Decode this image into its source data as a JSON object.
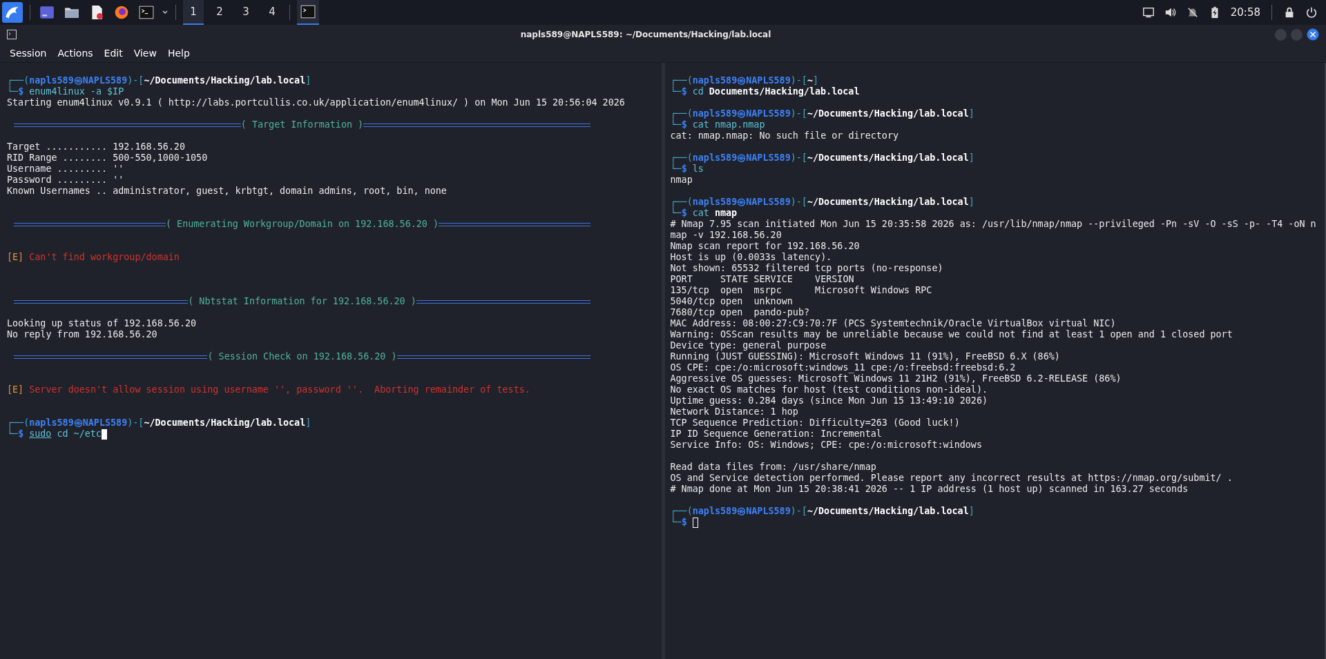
{
  "taskbar": {
    "workspaces": [
      {
        "label": "1",
        "selected": true
      },
      {
        "label": "2",
        "selected": false
      },
      {
        "label": "3",
        "selected": false
      },
      {
        "label": "4",
        "selected": false
      }
    ],
    "clock": "20:58"
  },
  "window": {
    "title": "napls589@NAPLS589: ~/Documents/Hacking/lab.local"
  },
  "menu": [
    "Session",
    "Actions",
    "Edit",
    "View",
    "Help"
  ],
  "panes": [
    {
      "focused": true,
      "lines": [
        {
          "kind": "prompt",
          "frame": "┌──(",
          "user": "napls589㉿NAPLS589",
          "sep": ")-[",
          "path": "~/Documents/Hacking/lab.local",
          "end": "]"
        },
        {
          "kind": "command",
          "prefix": "└─$",
          "segments": [
            {
              "kind": "program",
              "text": "enum4linux -a $IP"
            }
          ]
        },
        {
          "kind": "output",
          "text": "Starting enum4linux v0.9.1 ( http://labs.portcullis.co.uk/application/enum4linux/ ) on Mon Jun 15 20:56:04 2026"
        },
        {
          "kind": "blank"
        },
        {
          "kind": "banner",
          "text": "( Target Information )"
        },
        {
          "kind": "blank"
        },
        {
          "kind": "output",
          "text": "Target ........... 192.168.56.20"
        },
        {
          "kind": "output",
          "text": "RID Range ........ 500-550,1000-1050"
        },
        {
          "kind": "output",
          "text": "Username ......... ''"
        },
        {
          "kind": "output",
          "text": "Password ......... ''"
        },
        {
          "kind": "output",
          "text": "Known Usernames .. administrator, guest, krbtgt, domain admins, root, bin, none"
        },
        {
          "kind": "blank"
        },
        {
          "kind": "blank"
        },
        {
          "kind": "banner",
          "text": "( Enumerating Workgroup/Domain on 192.168.56.20 )"
        },
        {
          "kind": "blank"
        },
        {
          "kind": "blank"
        },
        {
          "kind": "error",
          "tag": "[E]",
          "text": "Can't find workgroup/domain"
        },
        {
          "kind": "blank"
        },
        {
          "kind": "blank"
        },
        {
          "kind": "blank"
        },
        {
          "kind": "banner",
          "text": "( Nbtstat Information for 192.168.56.20 )"
        },
        {
          "kind": "blank"
        },
        {
          "kind": "output",
          "text": "Looking up status of 192.168.56.20"
        },
        {
          "kind": "output",
          "text": "No reply from 192.168.56.20"
        },
        {
          "kind": "blank"
        },
        {
          "kind": "banner",
          "text": "( Session Check on 192.168.56.20 )"
        },
        {
          "kind": "blank"
        },
        {
          "kind": "blank"
        },
        {
          "kind": "error",
          "tag": "[E]",
          "text": "Server doesn't allow session using username '', password ''.  Aborting remainder of tests."
        },
        {
          "kind": "blank"
        },
        {
          "kind": "blank"
        },
        {
          "kind": "prompt",
          "frame": "┌──(",
          "user": "napls589㉿NAPLS589",
          "sep": ")-[",
          "path": "~/Documents/Hacking/lab.local",
          "end": "]"
        },
        {
          "kind": "command",
          "prefix": "└─$",
          "segments": [
            {
              "kind": "sudo",
              "text": "sudo"
            },
            {
              "kind": "program",
              "text": "cd ~/etc"
            }
          ],
          "cursor": true
        }
      ]
    },
    {
      "focused": false,
      "lines": [
        {
          "kind": "prompt",
          "frame": "┌──(",
          "user": "napls589㉿NAPLS589",
          "sep": ")-[",
          "path": "~",
          "end": "]"
        },
        {
          "kind": "command",
          "prefix": "└─$",
          "segments": [
            {
              "kind": "program",
              "text": "cd"
            },
            {
              "kind": "file",
              "text": "Documents/Hacking/lab.local"
            }
          ]
        },
        {
          "kind": "blank"
        },
        {
          "kind": "prompt",
          "frame": "┌──(",
          "user": "napls589㉿NAPLS589",
          "sep": ")-[",
          "path": "~/Documents/Hacking/lab.local",
          "end": "]"
        },
        {
          "kind": "command",
          "prefix": "└─$",
          "segments": [
            {
              "kind": "program",
              "text": "cat nmap.nmap"
            }
          ]
        },
        {
          "kind": "output",
          "text": "cat: nmap.nmap: No such file or directory"
        },
        {
          "kind": "blank"
        },
        {
          "kind": "prompt",
          "frame": "┌──(",
          "user": "napls589㉿NAPLS589",
          "sep": ")-[",
          "path": "~/Documents/Hacking/lab.local",
          "end": "]"
        },
        {
          "kind": "command",
          "prefix": "└─$",
          "segments": [
            {
              "kind": "program",
              "text": "ls"
            }
          ]
        },
        {
          "kind": "output",
          "text": "nmap"
        },
        {
          "kind": "blank"
        },
        {
          "kind": "prompt",
          "frame": "┌──(",
          "user": "napls589㉿NAPLS589",
          "sep": ")-[",
          "path": "~/Documents/Hacking/lab.local",
          "end": "]"
        },
        {
          "kind": "command",
          "prefix": "└─$",
          "segments": [
            {
              "kind": "program",
              "text": "cat"
            },
            {
              "kind": "file",
              "text": "nmap"
            }
          ]
        },
        {
          "kind": "output",
          "text": "# Nmap 7.95 scan initiated Mon Jun 15 20:35:58 2026 as: /usr/lib/nmap/nmap --privileged -Pn -sV -O -sS -p- -T4 -oN n"
        },
        {
          "kind": "output",
          "text": "map -v 192.168.56.20"
        },
        {
          "kind": "output",
          "text": "Nmap scan report for 192.168.56.20"
        },
        {
          "kind": "output",
          "text": "Host is up (0.0033s latency)."
        },
        {
          "kind": "output",
          "text": "Not shown: 65532 filtered tcp ports (no-response)"
        },
        {
          "kind": "output",
          "text": "PORT     STATE SERVICE    VERSION"
        },
        {
          "kind": "output",
          "text": "135/tcp  open  msrpc      Microsoft Windows RPC"
        },
        {
          "kind": "output",
          "text": "5040/tcp open  unknown"
        },
        {
          "kind": "output",
          "text": "7680/tcp open  pando-pub?"
        },
        {
          "kind": "output",
          "text": "MAC Address: 08:00:27:C9:70:7F (PCS Systemtechnik/Oracle VirtualBox virtual NIC)"
        },
        {
          "kind": "output",
          "text": "Warning: OSScan results may be unreliable because we could not find at least 1 open and 1 closed port"
        },
        {
          "kind": "output",
          "text": "Device type: general purpose"
        },
        {
          "kind": "output",
          "text": "Running (JUST GUESSING): Microsoft Windows 11 (91%), FreeBSD 6.X (86%)"
        },
        {
          "kind": "output",
          "text": "OS CPE: cpe:/o:microsoft:windows_11 cpe:/o:freebsd:freebsd:6.2"
        },
        {
          "kind": "output",
          "text": "Aggressive OS guesses: Microsoft Windows 11 21H2 (91%), FreeBSD 6.2-RELEASE (86%)"
        },
        {
          "kind": "output",
          "text": "No exact OS matches for host (test conditions non-ideal)."
        },
        {
          "kind": "output",
          "text": "Uptime guess: 0.284 days (since Mon Jun 15 13:49:10 2026)"
        },
        {
          "kind": "output",
          "text": "Network Distance: 1 hop"
        },
        {
          "kind": "output",
          "text": "TCP Sequence Prediction: Difficulty=263 (Good luck!)"
        },
        {
          "kind": "output",
          "text": "IP ID Sequence Generation: Incremental"
        },
        {
          "kind": "output",
          "text": "Service Info: OS: Windows; CPE: cpe:/o:microsoft:windows"
        },
        {
          "kind": "blank"
        },
        {
          "kind": "output",
          "text": "Read data files from: /usr/share/nmap"
        },
        {
          "kind": "output",
          "text": "OS and Service detection performed. Please report any incorrect results at https://nmap.org/submit/ ."
        },
        {
          "kind": "output",
          "text": "# Nmap done at Mon Jun 15 20:38:41 2026 -- 1 IP address (1 host up) scanned in 163.27 seconds"
        },
        {
          "kind": "blank"
        },
        {
          "kind": "prompt",
          "frame": "┌──(",
          "user": "napls589㉿NAPLS589",
          "sep": ")-[",
          "path": "~/Documents/Hacking/lab.local",
          "end": "]"
        },
        {
          "kind": "command",
          "prefix": "└─$",
          "cursor": true
        }
      ]
    }
  ]
}
